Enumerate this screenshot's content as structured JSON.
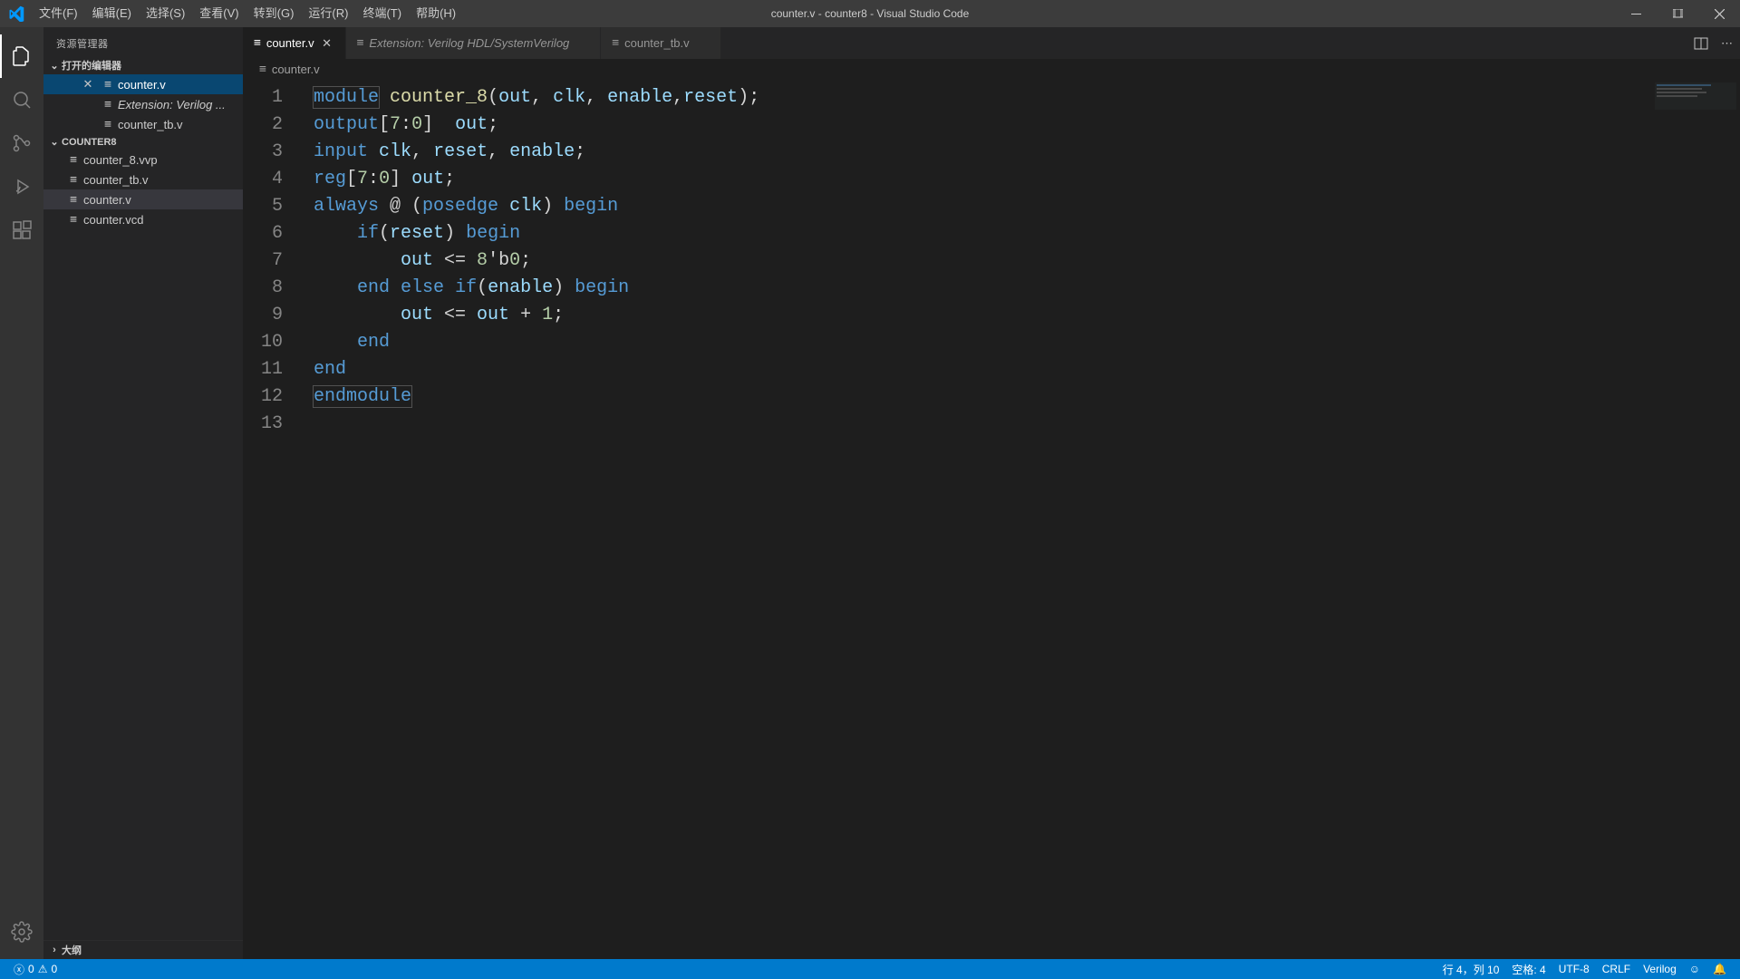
{
  "title": "counter.v - counter8 - Visual Studio Code",
  "menu": [
    "文件(F)",
    "编辑(E)",
    "选择(S)",
    "查看(V)",
    "转到(G)",
    "运行(R)",
    "终端(T)",
    "帮助(H)"
  ],
  "sidebar": {
    "title": "资源管理器",
    "sections": {
      "open_editors": {
        "label": "打开的编辑器",
        "items": [
          {
            "label": "counter.v",
            "close": true,
            "active": true
          },
          {
            "label": "Extension: Verilog ...",
            "close": false,
            "active": false
          },
          {
            "label": "counter_tb.v",
            "close": false,
            "active": false
          }
        ]
      },
      "folder": {
        "label": "COUNTER8",
        "items": [
          {
            "label": "counter_8.vvp"
          },
          {
            "label": "counter_tb.v"
          },
          {
            "label": "counter.v",
            "active": true
          },
          {
            "label": "counter.vcd"
          }
        ]
      },
      "outline": {
        "label": "大纲"
      }
    }
  },
  "tabs": [
    {
      "label": "counter.v",
      "active": true,
      "italic": false
    },
    {
      "label": "Extension: Verilog HDL/SystemVerilog",
      "active": false,
      "italic": true
    },
    {
      "label": "counter_tb.v",
      "active": false,
      "italic": false
    }
  ],
  "breadcrumb": "counter.v",
  "code_lines": [
    [
      [
        "kw",
        "module",
        true
      ],
      [
        "pn",
        " "
      ],
      [
        "fn",
        "counter_8"
      ],
      [
        "pn",
        "("
      ],
      [
        "id",
        "out"
      ],
      [
        "pn",
        ", "
      ],
      [
        "id",
        "clk"
      ],
      [
        "pn",
        ", "
      ],
      [
        "id",
        "enable"
      ],
      [
        "pn",
        ","
      ],
      [
        "id",
        "reset"
      ],
      [
        "pn",
        ");"
      ]
    ],
    [
      [
        "kw",
        "output"
      ],
      [
        "pn",
        "["
      ],
      [
        "nm",
        "7"
      ],
      [
        "pn",
        ":"
      ],
      [
        "nm",
        "0"
      ],
      [
        "pn",
        "]  "
      ],
      [
        "id",
        "out"
      ],
      [
        "pn",
        ";"
      ]
    ],
    [
      [
        "kw",
        "input"
      ],
      [
        "pn",
        " "
      ],
      [
        "id",
        "clk"
      ],
      [
        "pn",
        ", "
      ],
      [
        "id",
        "reset"
      ],
      [
        "pn",
        ", "
      ],
      [
        "id",
        "enable"
      ],
      [
        "pn",
        ";"
      ]
    ],
    [
      [
        "kw",
        "reg"
      ],
      [
        "pn",
        "["
      ],
      [
        "nm",
        "7"
      ],
      [
        "pn",
        ":"
      ],
      [
        "nm",
        "0"
      ],
      [
        "pn",
        "] "
      ],
      [
        "id",
        "out"
      ],
      [
        "pn",
        ";"
      ]
    ],
    [
      [
        "kw",
        "always"
      ],
      [
        "pn",
        " @ ("
      ],
      [
        "kw",
        "posedge"
      ],
      [
        "pn",
        " "
      ],
      [
        "id",
        "clk"
      ],
      [
        "pn",
        ") "
      ],
      [
        "kw",
        "begin"
      ]
    ],
    [
      [
        "pn",
        "    "
      ],
      [
        "kw",
        "if"
      ],
      [
        "pn",
        "("
      ],
      [
        "id",
        "reset"
      ],
      [
        "pn",
        ") "
      ],
      [
        "kw",
        "begin"
      ]
    ],
    [
      [
        "pn",
        "        "
      ],
      [
        "id",
        "out"
      ],
      [
        "pn",
        " <= "
      ],
      [
        "nm",
        "8"
      ],
      [
        "pn",
        "'b"
      ],
      [
        "nm",
        "0"
      ],
      [
        "pn",
        ";"
      ]
    ],
    [
      [
        "pn",
        "    "
      ],
      [
        "kw",
        "end"
      ],
      [
        "pn",
        " "
      ],
      [
        "kw",
        "else"
      ],
      [
        "pn",
        " "
      ],
      [
        "kw",
        "if"
      ],
      [
        "pn",
        "("
      ],
      [
        "id",
        "enable"
      ],
      [
        "pn",
        ") "
      ],
      [
        "kw",
        "begin"
      ]
    ],
    [
      [
        "pn",
        "        "
      ],
      [
        "id",
        "out"
      ],
      [
        "pn",
        " <= "
      ],
      [
        "id",
        "out"
      ],
      [
        "pn",
        " + "
      ],
      [
        "nm",
        "1"
      ],
      [
        "pn",
        ";"
      ]
    ],
    [
      [
        "pn",
        "    "
      ],
      [
        "kw",
        "end"
      ]
    ],
    [
      [
        "kw",
        "end"
      ]
    ],
    [
      [
        "kw",
        "endmodule",
        true
      ]
    ],
    []
  ],
  "status": {
    "errors": "0",
    "warnings": "0",
    "ln_col": "行 4，列 10",
    "spaces": "空格: 4",
    "encoding": "UTF-8",
    "eol": "CRLF",
    "lang": "Verilog",
    "feedback": "☺",
    "bell": "🔔"
  }
}
